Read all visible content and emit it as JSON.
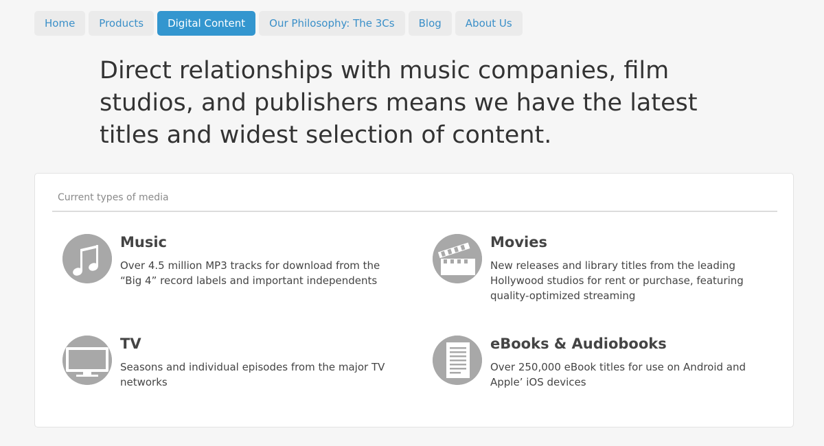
{
  "nav": {
    "items": [
      {
        "label": "Home"
      },
      {
        "label": "Products"
      },
      {
        "label": "Digital Content"
      },
      {
        "label": "Our Philosophy: The 3Cs"
      },
      {
        "label": "Blog"
      },
      {
        "label": "About Us"
      }
    ],
    "active_index": 2,
    "active_color": "#3396cf",
    "link_color": "#3a8fc8"
  },
  "headline": "Direct relationships with music companies, film studios, and publishers means we have the latest titles and widest selection of content.",
  "media_panel": {
    "title": "Current types of media",
    "items": [
      {
        "icon": "music-note-icon",
        "title": "Music",
        "description": "Over 4.5 million MP3 tracks for download from the “Big 4” record labels and important independents"
      },
      {
        "icon": "clapperboard-icon",
        "title": "Movies",
        "description": "New releases and library titles from the leading Hollywood studios for rent or purchase, featuring quality-optimized streaming"
      },
      {
        "icon": "tv-icon",
        "title": "TV",
        "description": "Seasons and individual episodes from the major TV networks"
      },
      {
        "icon": "book-icon",
        "title": "eBooks & Audiobooks",
        "description": "Over 250,000 eBook titles for use on Android and Apple’ iOS devices"
      }
    ]
  }
}
